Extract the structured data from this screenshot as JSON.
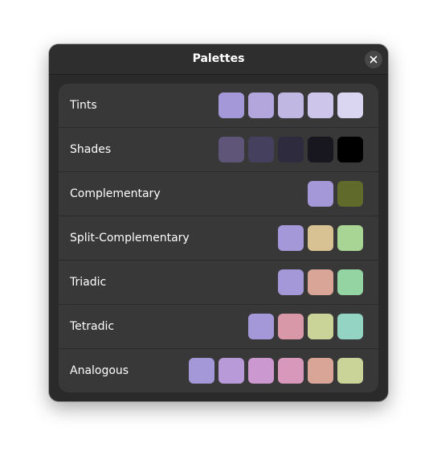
{
  "window": {
    "title": "Palettes"
  },
  "rows": [
    {
      "label": "Tints",
      "colors": [
        "#a598d8",
        "#b2a6dd",
        "#c0b7e3",
        "#cdc5ea",
        "#dad5f0"
      ]
    },
    {
      "label": "Shades",
      "colors": [
        "#5f5579",
        "#45405e",
        "#2e2b3f",
        "#18171f",
        "#000000"
      ]
    },
    {
      "label": "Complementary",
      "colors": [
        "#a598d8",
        "#5f6a2b"
      ]
    },
    {
      "label": "Split-Complementary",
      "colors": [
        "#a598d8",
        "#d8c294",
        "#a8d494"
      ]
    },
    {
      "label": "Triadic",
      "colors": [
        "#a598d8",
        "#d8a596",
        "#94d4a2"
      ]
    },
    {
      "label": "Tetradic",
      "colors": [
        "#a598d8",
        "#d898a8",
        "#cad498",
        "#94d4c2"
      ]
    },
    {
      "label": "Analogous",
      "colors": [
        "#a598d8",
        "#b89ad8",
        "#cc98d0",
        "#d898bc",
        "#d8a596",
        "#cad498"
      ]
    }
  ]
}
